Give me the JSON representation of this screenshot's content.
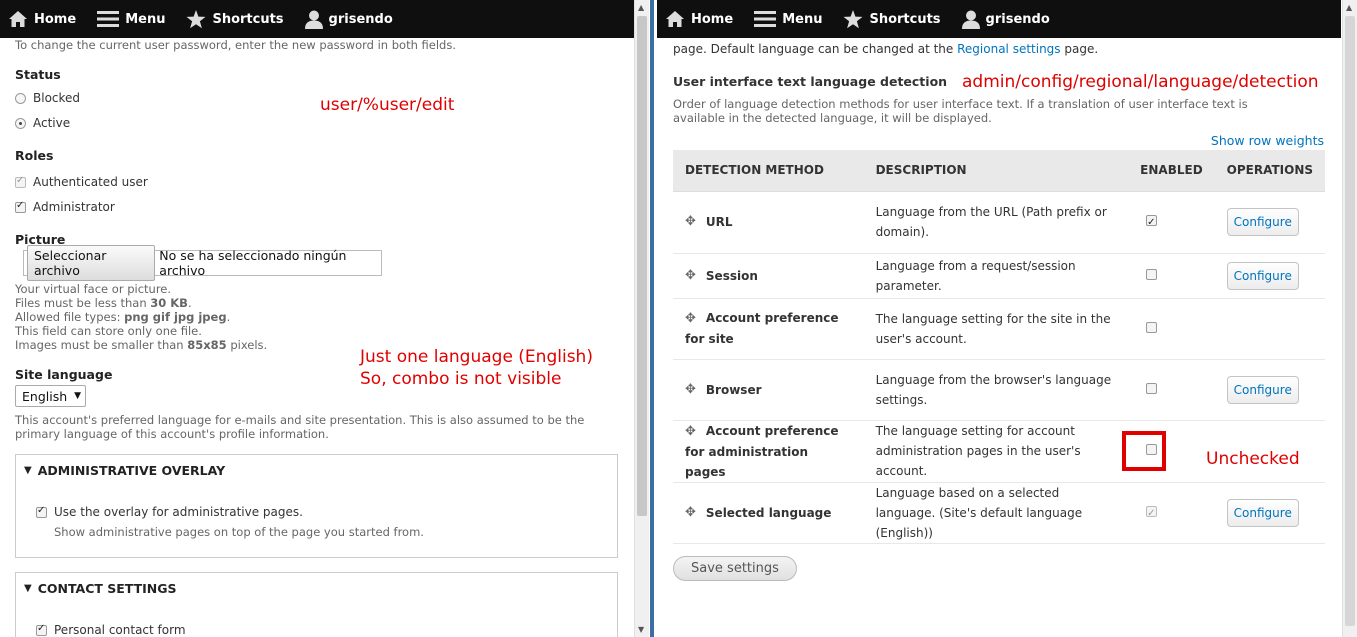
{
  "toolbar": {
    "home": "Home",
    "menu": "Menu",
    "shortcuts": "Shortcuts",
    "user": "grisendo"
  },
  "left": {
    "password_hint": "To change the current user password, enter the new password in both fields.",
    "status_label": "Status",
    "status_options": [
      "Blocked",
      "Active"
    ],
    "status_selected": "Active",
    "roles_label": "Roles",
    "roles": [
      "Authenticated user",
      "Administrator"
    ],
    "picture_label": "Picture",
    "file_button": "Seleccionar archivo",
    "file_status": "No se ha seleccionado ningún archivo",
    "picture_help": {
      "line1": "Your virtual face or picture.",
      "line2_pre": "Files must be less than ",
      "line2_bold": "30 KB",
      "line2_post": ".",
      "line3_pre": "Allowed file types: ",
      "line3_bold": "png gif jpg jpeg",
      "line3_post": ".",
      "line4": "This field can store only one file.",
      "line5_pre": "Images must be smaller than ",
      "line5_bold": "85x85",
      "line5_post": " pixels."
    },
    "site_language_label": "Site language",
    "site_language_value": "English",
    "site_language_help": "This account's preferred language for e-mails and site presentation. This is also assumed to be the primary language of this account's profile information.",
    "overlay_legend": "ADMINISTRATIVE OVERLAY",
    "overlay_option": "Use the overlay for administrative pages.",
    "overlay_help": "Show administrative pages on top of the page you started from.",
    "contact_legend": "CONTACT SETTINGS",
    "contact_option": "Personal contact form",
    "annot_path": "user/%user/edit",
    "annot_line1": "Just one language (English)",
    "annot_line2": "So, combo is not visible"
  },
  "right": {
    "intro_pre": "page. Default language can be changed at the ",
    "intro_link": "Regional settings",
    "intro_post": " page.",
    "section_title": "User interface text language detection",
    "section_desc": "Order of language detection methods for user interface text. If a translation of user interface text is available in the detected language, it will be displayed.",
    "show_row_weights": "Show row weights",
    "annot_path": "admin/config/regional/language/detection",
    "annot_unchecked": "Unchecked",
    "headers": [
      "DETECTION METHOD",
      "DESCRIPTION",
      "ENABLED",
      "OPERATIONS"
    ],
    "rows": [
      {
        "method": "URL",
        "desc": "Language from the URL (Path prefix or domain).",
        "enabled": "checked",
        "op": "Configure"
      },
      {
        "method": "Session",
        "desc": "Language from a request/session parameter.",
        "enabled": "unchecked",
        "op": "Configure"
      },
      {
        "method": "Account preference for site",
        "desc": "The language setting for the site in the user's account.",
        "enabled": "unchecked",
        "op": ""
      },
      {
        "method": "Browser",
        "desc": "Language from the browser's language settings.",
        "enabled": "unchecked",
        "op": "Configure"
      },
      {
        "method": "Account preference for administration pages",
        "desc": "The language setting for account administration pages in the user's account.",
        "enabled": "unchecked",
        "op": ""
      },
      {
        "method": "Selected language",
        "desc": "Language based on a selected language. (Site's default language (English))",
        "enabled": "disabled",
        "op": "Configure"
      }
    ],
    "save_button": "Save settings"
  }
}
